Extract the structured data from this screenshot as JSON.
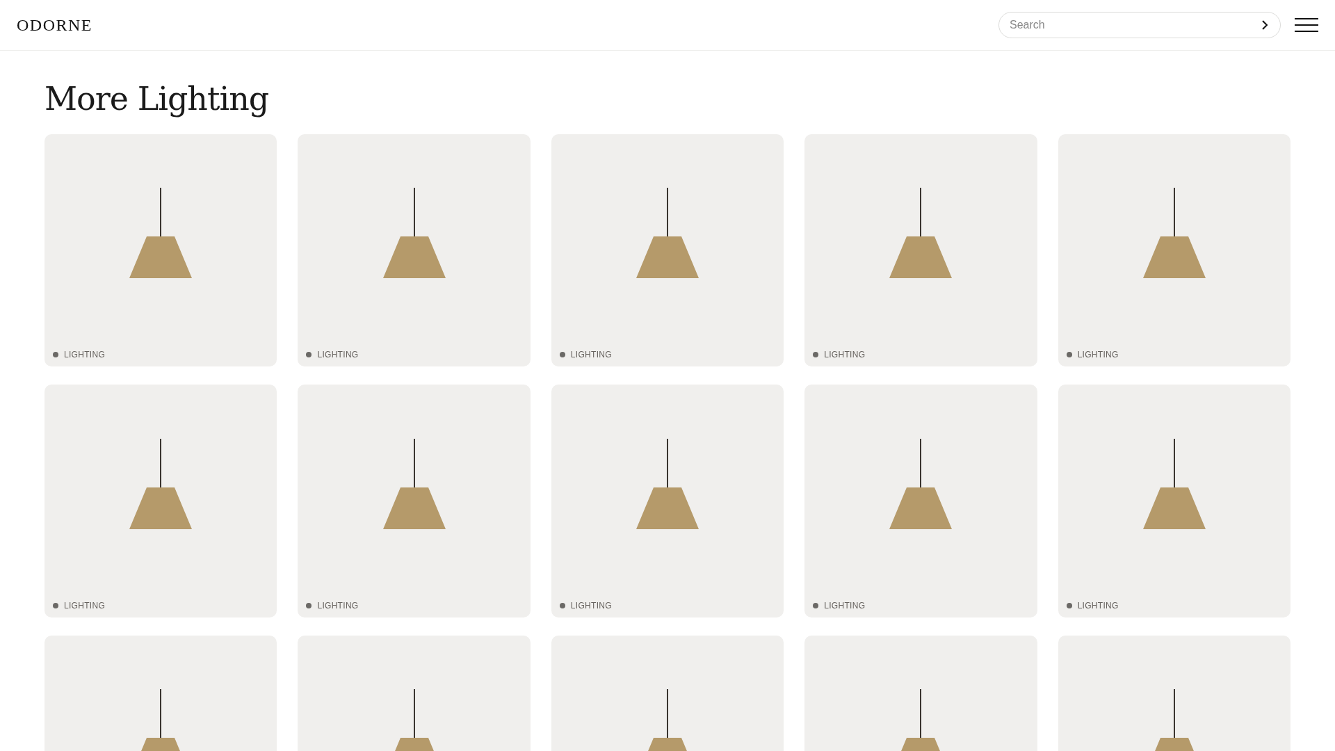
{
  "header": {
    "brand": "ODORNE",
    "search": {
      "placeholder": "Search"
    }
  },
  "heading": "More Lighting",
  "products": [
    {
      "kind": "labelled",
      "category": "LIGHTING"
    },
    {
      "kind": "labelled",
      "category": "LIGHTING"
    },
    {
      "kind": "labelled",
      "category": "LIGHTING"
    },
    {
      "kind": "labelled",
      "category": "LIGHTING"
    },
    {
      "kind": "labelled",
      "category": "LIGHTING"
    },
    {
      "kind": "labelled",
      "category": "LIGHTING"
    },
    {
      "kind": "labelled",
      "category": "LIGHTING"
    },
    {
      "kind": "labelled",
      "category": "LIGHTING"
    },
    {
      "kind": "labelled",
      "category": "LIGHTING"
    },
    {
      "kind": "labelled",
      "category": "LIGHTING"
    },
    {
      "kind": "photo"
    },
    {
      "kind": "photo"
    },
    {
      "kind": "photo"
    },
    {
      "kind": "photo"
    },
    {
      "kind": "photo"
    }
  ]
}
